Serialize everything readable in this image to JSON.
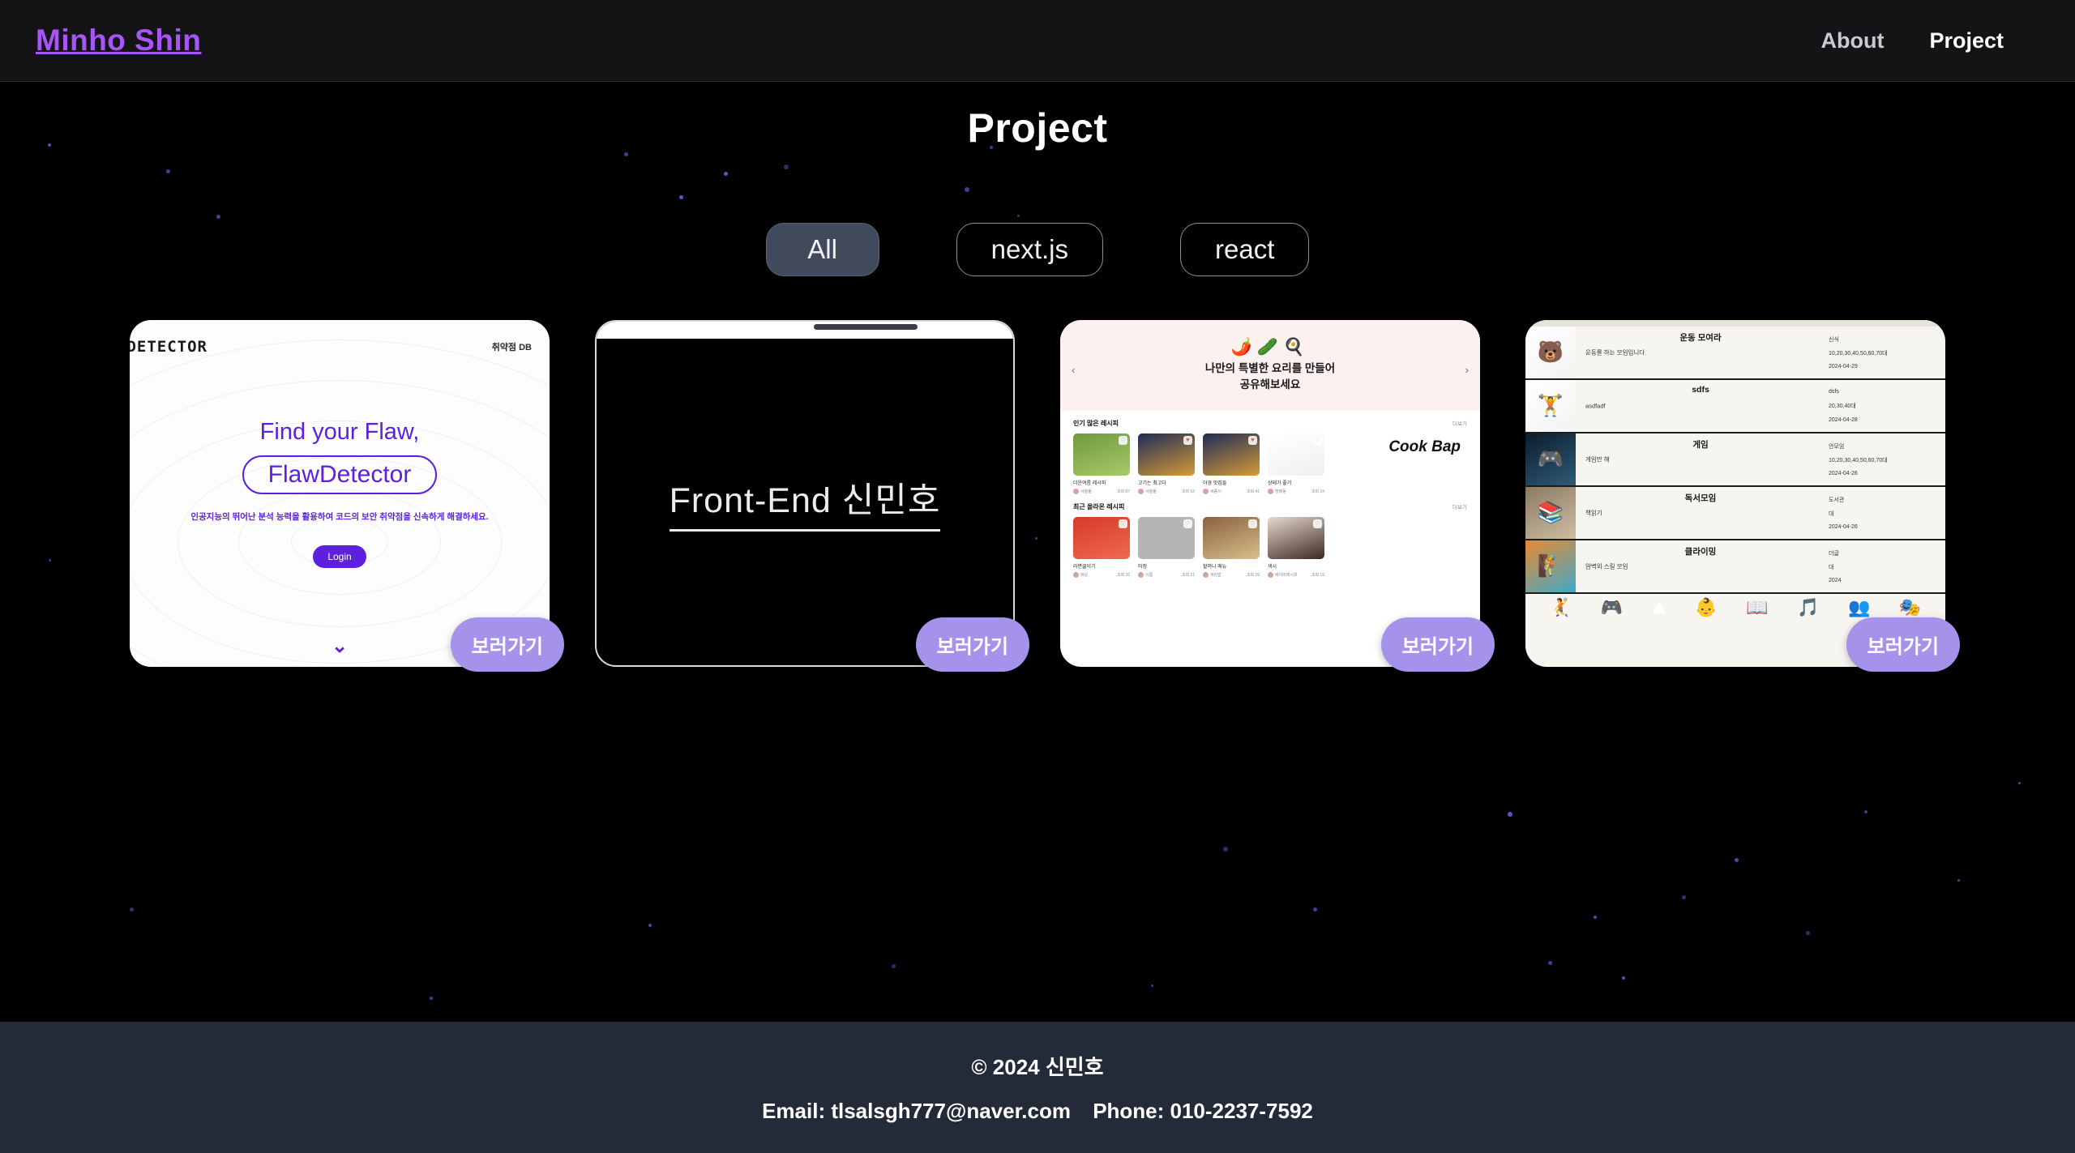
{
  "header": {
    "logo": "Minho Shin",
    "nav": [
      {
        "label": "About",
        "active": false
      },
      {
        "label": "Project",
        "active": true
      }
    ]
  },
  "page": {
    "title": "Project"
  },
  "filters": [
    {
      "label": "All",
      "active": true
    },
    {
      "label": "next.js",
      "active": false
    },
    {
      "label": "react",
      "active": false
    }
  ],
  "visit_button_label": "보러가기",
  "projects": [
    {
      "id": "flawdetector",
      "logo": "/DETECTOR",
      "db_label": "취약점 DB",
      "headline": "Find your Flaw,",
      "pill": "FlawDetector",
      "subtitle": "인공지능의 뛰어난 분석 능력을 활용하여 코드의 보안 취약점을 신속하게 해결하세요.",
      "login_label": "Login",
      "scroll_icon": "chevron-double-down"
    },
    {
      "id": "frontend-portfolio",
      "title": "Front-End 신민호"
    },
    {
      "id": "cookbap",
      "emojis": "🌶️🥒🍳",
      "hero_line1": "나만의 특별한 요리를 만들어",
      "hero_line2": "공유해보세요",
      "arrow_left": "‹",
      "arrow_right": "›",
      "brand": "Cook Bap",
      "sections": [
        {
          "title": "인기 많은 레시피",
          "more": "더보기",
          "items": [
            {
              "name": "더운여름 레시피",
              "author": "서울물",
              "stat": "조회 87",
              "liked": false,
              "color1": "#6f9a3c",
              "color2": "#a8c96a"
            },
            {
              "name": "고기는 최고다",
              "author": "서울물",
              "stat": "조회 62",
              "liked": true,
              "color1": "#1d2c56",
              "color2": "#d79a3a"
            },
            {
              "name": "야경 맛집들",
              "author": "세종시",
              "stat": "조회 41",
              "liked": true,
              "color1": "#1d2c56",
              "color2": "#d79a3a"
            },
            {
              "name": "상태가 좋기",
              "author": "방배동",
              "stat": "조회 24",
              "liked": false,
              "color1": "#ffffff",
              "color2": "#f0f0f0"
            }
          ]
        },
        {
          "title": "최근 올라온 레시피",
          "more": "더보기",
          "items": [
            {
              "name": "라면끓이기",
              "author": "매운",
              "stat": "조회 20",
              "liked": false,
              "color1": "#d63a28",
              "color2": "#ef6a50"
            },
            {
              "name": "미정",
              "author": "이름",
              "stat": "조회 21",
              "liked": false,
              "color1": "#b5b5b5",
              "color2": "#b5b5b5"
            },
            {
              "name": "할머니 메뉴",
              "author": "계란밥",
              "stat": "조회 29",
              "liked": false,
              "color1": "#8a6240",
              "color2": "#d9bf8a"
            },
            {
              "name": "색시",
              "author": "베이비레시피",
              "stat": "조회 19",
              "liked": false,
              "color1": "#e8d9cd",
              "color2": "#3a2a22"
            }
          ]
        }
      ]
    },
    {
      "id": "meetup",
      "rows": [
        {
          "title": "운동 모여라",
          "desc": "운동를 하는 모임입니다.",
          "place": "신식",
          "ages": "10,20,30,40,50,60,70대",
          "date": "2024-04-29",
          "icon": "🐻",
          "thumb1": "#ffffff",
          "thumb2": "#f3f3f3"
        },
        {
          "title": "sdfs",
          "desc": "asdfadf",
          "place": "dsfs",
          "ages": "20,30,40대",
          "date": "2024-04-28",
          "icon": "🏋",
          "thumb1": "#ffffff",
          "thumb2": "#f3f3f3"
        },
        {
          "title": "게임",
          "desc": "게임만 해",
          "place": "안모임",
          "ages": "10,20,30,40,50,60,70대",
          "date": "2024-04-26",
          "icon": "🎮",
          "thumb1": "#0d1c2a",
          "thumb2": "#2e5c78"
        },
        {
          "title": "독서모임",
          "desc": "책읽기",
          "place": "도서관",
          "ages": "대",
          "date": "2024-04-26",
          "icon": "📚",
          "thumb1": "#8c7b63",
          "thumb2": "#cdbda2"
        },
        {
          "title": "클라이밍",
          "desc": "암벽외 스킬 모임",
          "place": "더글",
          "ages": "대",
          "date": "2024",
          "icon": "🧗",
          "thumb1": "#e98a30",
          "thumb2": "#3fa9c9"
        }
      ],
      "category_icons": [
        "🤾",
        "🎮",
        "⛰",
        "👶",
        "📖",
        "🎵",
        "👥",
        "🎭"
      ]
    }
  ],
  "footer": {
    "copyright": "© 2024 신민호",
    "email": "Email: tlsalsgh777@naver.com",
    "phone": "Phone: 010-2237-7592"
  },
  "colors": {
    "accent_purple": "#a855f7",
    "visit_button": "#a593eb",
    "flaw_purple": "#5d1fe0",
    "footer_bg": "#242b38",
    "filter_active_bg": "#414a5c"
  }
}
